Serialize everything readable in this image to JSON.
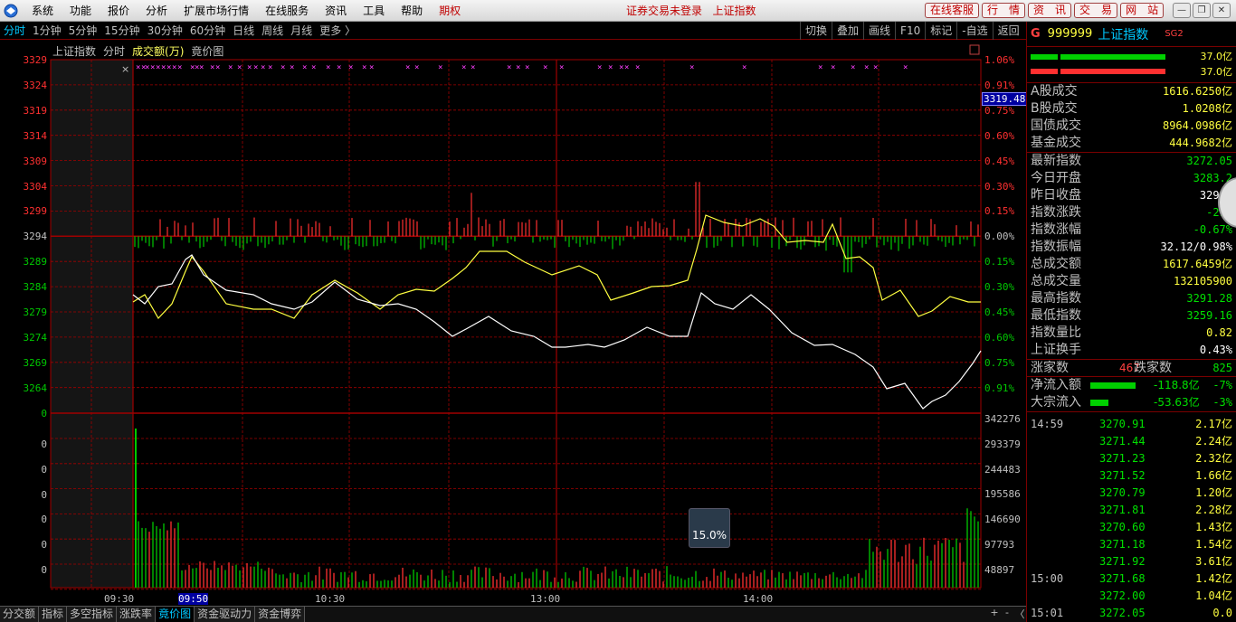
{
  "menubar": {
    "items": [
      "系统",
      "功能",
      "报价",
      "分析",
      "扩展市场行情",
      "在线服务",
      "资讯",
      "工具",
      "帮助"
    ],
    "highlight": "期权",
    "center_text": "证券交易未登录",
    "center_text2": "上证指数",
    "right_buttons": [
      "在线客服",
      "行　情",
      "资　讯",
      "交　易",
      "网　站"
    ]
  },
  "periodbar": {
    "items": [
      "分时",
      "1分钟",
      "5分钟",
      "15分钟",
      "30分钟",
      "60分钟",
      "日线",
      "周线",
      "月线",
      "更多 〉"
    ],
    "active": 0,
    "tools": [
      "切换",
      "叠加",
      "画线",
      "F10",
      "标记",
      "-自选",
      "返回"
    ]
  },
  "chart": {
    "subtitle": {
      "name": "上证指数",
      "mode": "分时",
      "vol_label": "成交额(万)",
      "bid_label": "竟价图"
    },
    "price_labels": [
      "3329",
      "3324",
      "3319",
      "3314",
      "3309",
      "3304",
      "3299",
      "3294",
      "3289",
      "3284",
      "3279",
      "3274",
      "3269",
      "3264",
      "0"
    ],
    "pct_labels": [
      "1.06%",
      "0.91%",
      "0.75%",
      "0.60%",
      "0.45%",
      "0.30%",
      "0.15%",
      "0.00%",
      "0.15%",
      "0.30%",
      "0.45%",
      "0.60%",
      "0.75%",
      "0.91%"
    ],
    "current_price_tag": "3319.48",
    "vol_left_labels": [
      "0",
      "0",
      "0",
      "0",
      "0",
      "0"
    ],
    "vol_right_labels": [
      "342276",
      "293379",
      "244483",
      "195586",
      "146690",
      "97793",
      "48897"
    ],
    "time_labels": [
      "09:30",
      "09:50",
      "10:30",
      "13:00",
      "14:00"
    ],
    "tooltip": "15.0%",
    "colors": {
      "up": "#ff3030",
      "down": "#00c800",
      "price": "#ffffff",
      "avg": "#ffff40",
      "grid": "#a00000",
      "bid": "#ff40ff"
    }
  },
  "tabs": [
    "分交额",
    "指标",
    "多空指标",
    "涨跌率",
    "竟价图",
    "资金驱动力",
    "资金博弈"
  ],
  "tabs_active": 4,
  "tabs_nav": [
    "+",
    "-",
    "〈"
  ],
  "panel": {
    "g": "G",
    "code": "999999",
    "name": "上证指数",
    "sg": "SG2",
    "bar_values": [
      "37.0亿",
      "37.0亿"
    ],
    "trades": [
      {
        "label": "A股成交",
        "value": "1616.6250亿"
      },
      {
        "label": "B股成交",
        "value": "1.0208亿"
      },
      {
        "label": "国债成交",
        "value": "8964.0986亿"
      },
      {
        "label": "基金成交",
        "value": "444.9682亿"
      }
    ],
    "quotes": [
      {
        "label": "最新指数",
        "value": "3272.05",
        "c": "#00e000"
      },
      {
        "label": "今日开盘",
        "value": "3283.2",
        "c": "#00e000"
      },
      {
        "label": "昨日收盘",
        "value": "3293.",
        "c": "#ffffff"
      },
      {
        "label": "指数涨跌",
        "value": "-21.",
        "c": "#00e000"
      },
      {
        "label": "指数涨幅",
        "value": "-0.67%",
        "c": "#00e000"
      },
      {
        "label": "指数振幅",
        "value": "32.12/0.98%",
        "c": "#ffffff"
      },
      {
        "label": "总成交额",
        "value": "1617.6459亿",
        "c": "#ffff40"
      },
      {
        "label": "总成交量",
        "value": "132105900",
        "c": "#ffff40"
      },
      {
        "label": "最高指数",
        "value": "3291.28",
        "c": "#00e000"
      },
      {
        "label": "最低指数",
        "value": "3259.16",
        "c": "#00e000"
      },
      {
        "label": "指数量比",
        "value": "0.82",
        "c": "#ffff40"
      },
      {
        "label": "上证换手",
        "value": "0.43%",
        "c": "#ffffff"
      }
    ],
    "adv_label": "涨家数",
    "adv": "467",
    "dec_label": "跌家数",
    "dec": "825",
    "flows": [
      {
        "label": "净流入额",
        "value": "-118.8亿",
        "pct": "-7%"
      },
      {
        "label": "大宗流入",
        "value": "-53.63亿",
        "pct": "-3%"
      }
    ],
    "ticks": [
      {
        "t": "14:59",
        "p": "3270.91",
        "v": "2.17亿"
      },
      {
        "t": "",
        "p": "3271.44",
        "v": "2.24亿"
      },
      {
        "t": "",
        "p": "3271.23",
        "v": "2.32亿"
      },
      {
        "t": "",
        "p": "3271.52",
        "v": "1.66亿"
      },
      {
        "t": "",
        "p": "3270.79",
        "v": "1.20亿"
      },
      {
        "t": "",
        "p": "3271.81",
        "v": "2.28亿"
      },
      {
        "t": "",
        "p": "3270.60",
        "v": "1.43亿"
      },
      {
        "t": "",
        "p": "3271.18",
        "v": "1.54亿"
      },
      {
        "t": "",
        "p": "3271.92",
        "v": "3.61亿"
      },
      {
        "t": "15:00",
        "p": "3271.68",
        "v": "1.42亿"
      },
      {
        "t": "",
        "p": "3272.00",
        "v": "1.04亿"
      },
      {
        "t": "15:01",
        "p": "3272.05",
        "v": "0.0"
      }
    ]
  }
}
